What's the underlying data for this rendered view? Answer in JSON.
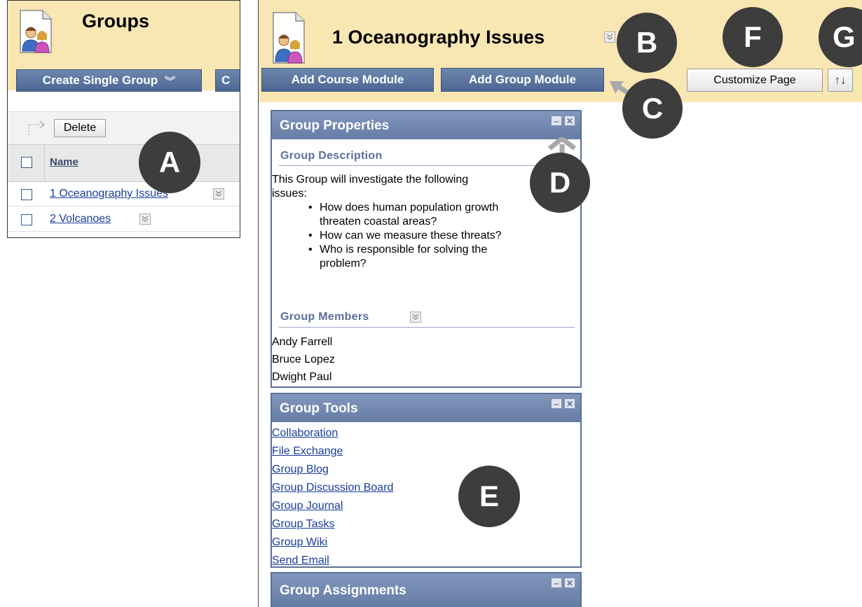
{
  "left": {
    "title": "Groups",
    "action_buttons": [
      "Create Single Group",
      "C"
    ],
    "delete_label": "Delete",
    "column_header": "Name",
    "groups": [
      "1 Oceanography Issues",
      "2 Volcanoes"
    ]
  },
  "right": {
    "title": "1 Oceanography Issues",
    "buttons": {
      "add_course_module": "Add Course Module",
      "add_group_module": "Add Group Module",
      "customize_page": "Customize Page",
      "reorder": "↑↓"
    },
    "properties": {
      "title": "Group Properties",
      "description_heading": "Group Description",
      "intro_line1": "This Group will investigate the following",
      "intro_line2": "issues:",
      "bullets": [
        [
          "How does human population growth",
          "threaten coastal areas?"
        ],
        [
          "How can we measure these threats?"
        ],
        [
          "Who is responsible for solving the",
          "problem?"
        ]
      ],
      "members_heading": "Group Members",
      "members": [
        "Andy Farrell",
        "Bruce Lopez",
        "Dwight Paul"
      ]
    },
    "tools": {
      "title": "Group Tools",
      "links": [
        "Collaboration",
        "File Exchange",
        "Group Blog",
        "Group Discussion Board",
        "Group Journal",
        "Group Tasks",
        "Group Wiki",
        "Send Email"
      ]
    },
    "assignments": {
      "title": "Group Assignments"
    }
  },
  "callouts": [
    "A",
    "B",
    "C",
    "D",
    "E",
    "F",
    "G"
  ],
  "colors": {
    "header_bg": "#f8e6b3",
    "button_blue": "#4c6793",
    "module_border": "#5a7097",
    "callout": "#3d3d3d"
  }
}
